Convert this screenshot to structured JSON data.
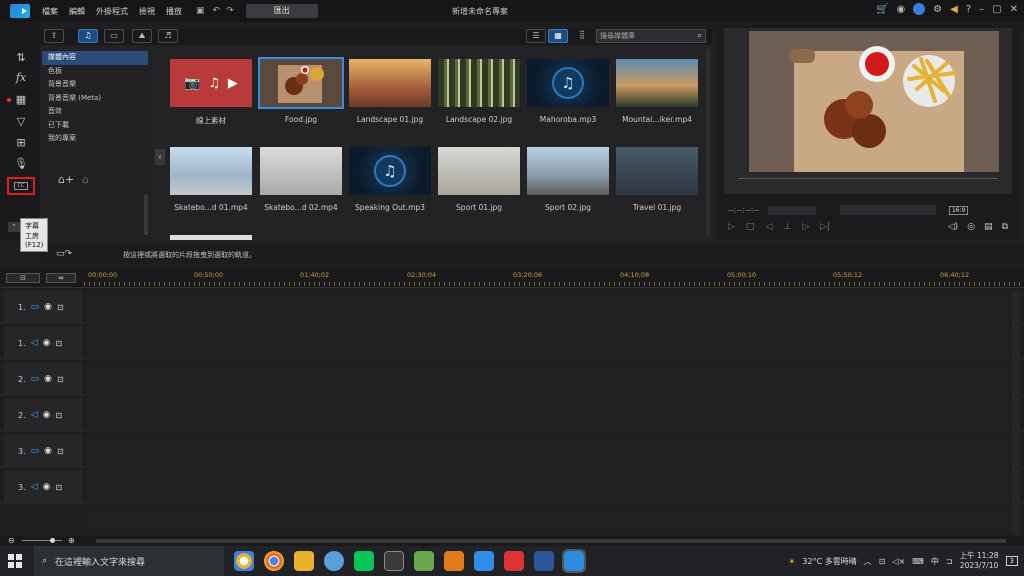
{
  "titlebar": {
    "menu": [
      "檔案",
      "編輯",
      "外掛程式",
      "檢視",
      "播放"
    ],
    "export_label": "匯出",
    "project_title": "新增未命名專案",
    "undo_icon": "undo-icon",
    "redo_icon": "redo-icon"
  },
  "rail": {
    "tooltip": "字幕工房 (F12)"
  },
  "library_nav": {
    "items": [
      "媒體內容",
      "色板",
      "背景音樂",
      "背景音樂 (Meta)",
      "音效",
      "已下載",
      "我的專案"
    ]
  },
  "library_toolbar": {
    "search_placeholder": "搜尋媒體庫"
  },
  "media": {
    "row1": [
      "線上素材",
      "Food.jpg",
      "Landscape 01.jpg",
      "Landscape 02.jpg",
      "Mahoroba.mp3",
      "Mountai...iker.mp4"
    ],
    "row2": [
      "Skatebo...d 01.mp4",
      "Skatebo...d 02.mp4",
      "Speaking Out.mp3",
      "Sport 01.jpg",
      "Sport 02.jpg",
      "Travel 01.jpg"
    ]
  },
  "preview": {
    "timecode": "--:--:--:--",
    "aspect": "16:9"
  },
  "strip": {
    "hint": "按這裡或將選取的片段拖曳到選取的軌道。"
  },
  "ruler": {
    "marks": [
      "00;00;00",
      "00;50;00",
      "01;40;02",
      "02;30;04",
      "03;20;06",
      "04;10;08",
      "05;00;10",
      "05;50;12",
      "06;40;12"
    ]
  },
  "tracks": [
    {
      "label": "1.",
      "type": "video"
    },
    {
      "label": "1.",
      "type": "audio"
    },
    {
      "label": "2.",
      "type": "video"
    },
    {
      "label": "2.",
      "type": "audio"
    },
    {
      "label": "3.",
      "type": "video"
    },
    {
      "label": "3.",
      "type": "audio"
    }
  ],
  "taskbar": {
    "search_placeholder": "在這裡輸入文字來搜尋",
    "weather": "32°C 多雲時晴",
    "ime": "中",
    "time": "上午 11:28",
    "date": "2023/7/10",
    "notifications": "3"
  }
}
